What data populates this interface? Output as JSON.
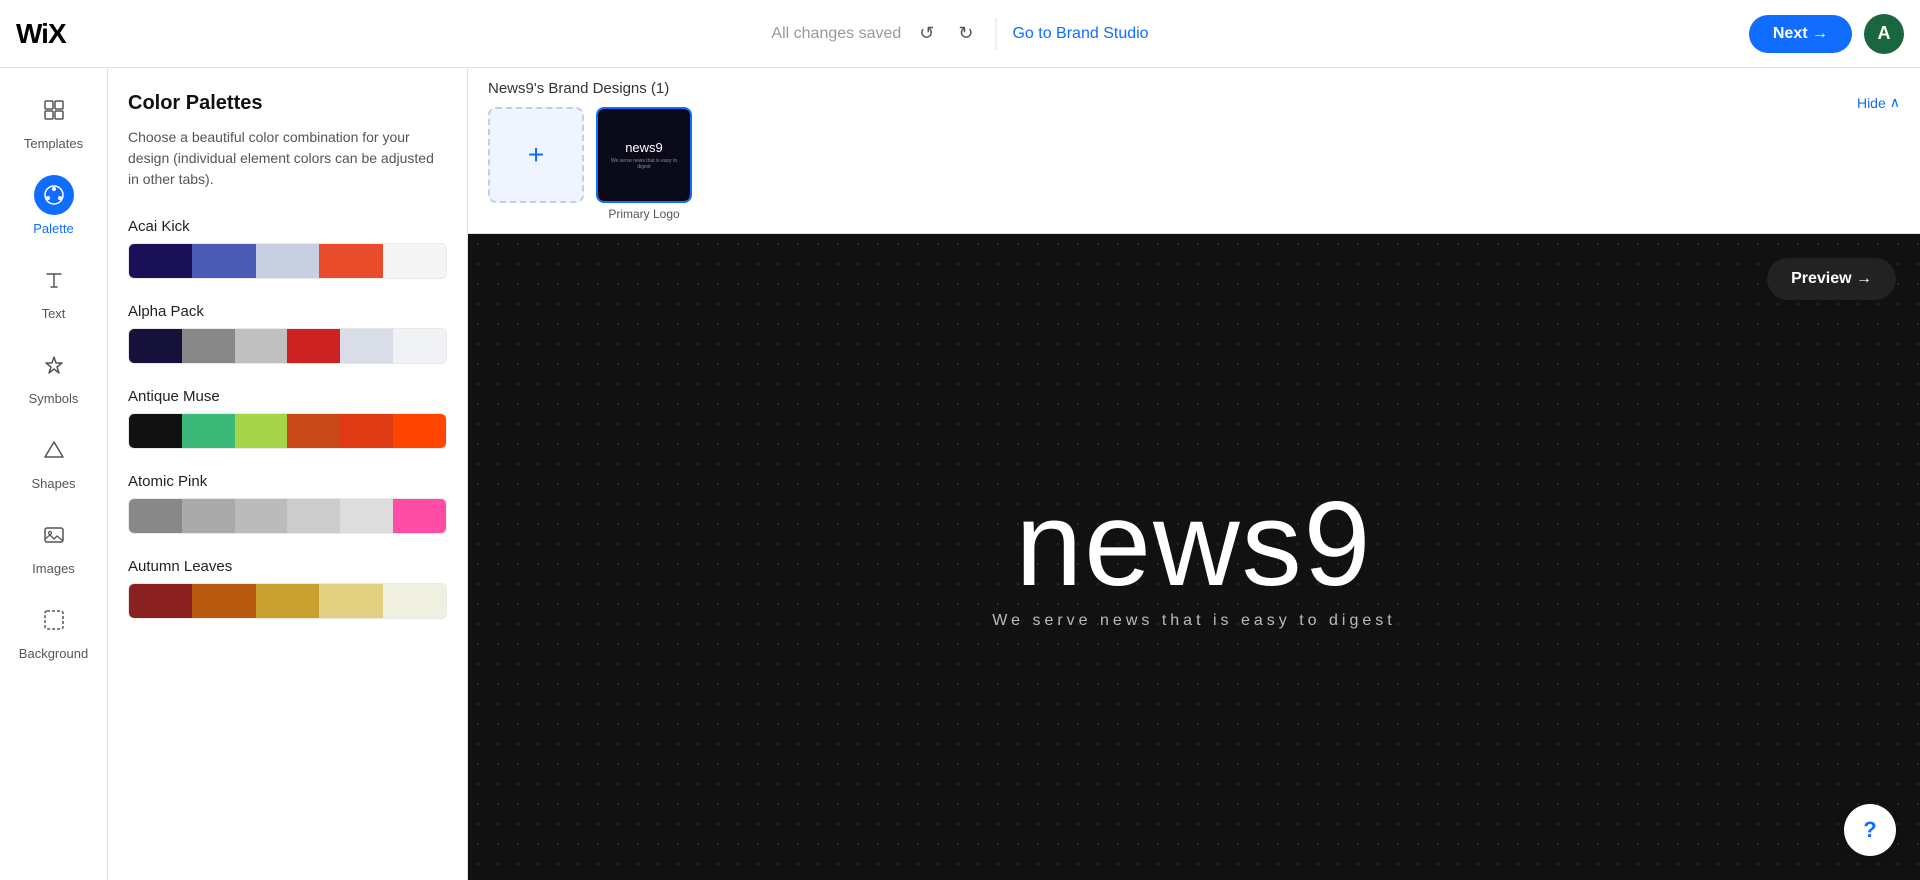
{
  "header": {
    "logo": "WiX",
    "status": "All changes saved",
    "undo_label": "↺",
    "redo_label": "↻",
    "brand_studio_label": "Go to Brand Studio",
    "next_label": "Next →",
    "avatar_letter": "A"
  },
  "sidebar": {
    "items": [
      {
        "id": "templates",
        "label": "Templates",
        "icon": "⊞",
        "active": false
      },
      {
        "id": "palette",
        "label": "Palette",
        "icon": "◉",
        "active": true
      },
      {
        "id": "text",
        "label": "Text",
        "icon": "T",
        "active": false
      },
      {
        "id": "symbols",
        "label": "Symbols",
        "icon": "☆",
        "active": false
      },
      {
        "id": "shapes",
        "label": "Shapes",
        "icon": "△",
        "active": false
      },
      {
        "id": "images",
        "label": "Images",
        "icon": "⊡",
        "active": false
      },
      {
        "id": "background",
        "label": "Background",
        "icon": "⊘",
        "active": false
      }
    ]
  },
  "palette_panel": {
    "title": "Color Palettes",
    "description": "Choose a beautiful color combination for your design (individual element colors can be adjusted in other tabs).",
    "palettes": [
      {
        "name": "Acai Kick",
        "colors": [
          "#1a1058",
          "#4a5bb5",
          "#c8cfe0",
          "#e84c2b",
          "#f5f5f5"
        ]
      },
      {
        "name": "Alpha Pack",
        "colors": [
          "#16113a",
          "#888888",
          "#c0c0c0",
          "#cc2222",
          "#d8dde8",
          "#f0f2f5"
        ]
      },
      {
        "name": "Antique Muse",
        "colors": [
          "#111111",
          "#3cb878",
          "#a8d44a",
          "#c84a18",
          "#e03a14",
          "#ff4500"
        ]
      },
      {
        "name": "Atomic Pink",
        "colors": [
          "#888888",
          "#aaaaaa",
          "#bbbbbb",
          "#cccccc",
          "#dddddd",
          "#ff4da6"
        ]
      },
      {
        "name": "Autumn Leaves",
        "colors": [
          "#8b2020",
          "#b85a10",
          "#c8a030",
          "#e0d080",
          "#f0f0e0"
        ]
      }
    ]
  },
  "brand_bar": {
    "title": "News9's Brand Designs (1)",
    "hide_label": "Hide",
    "add_label": "+",
    "primary_logo_label": "Primary Logo",
    "logo_text": "news9",
    "logo_subtext": "We serve news that is easy to digest"
  },
  "preview": {
    "logo_text": "news9",
    "tagline": "We serve news that is easy to digest",
    "preview_btn": "Preview →",
    "help_btn": "?"
  }
}
